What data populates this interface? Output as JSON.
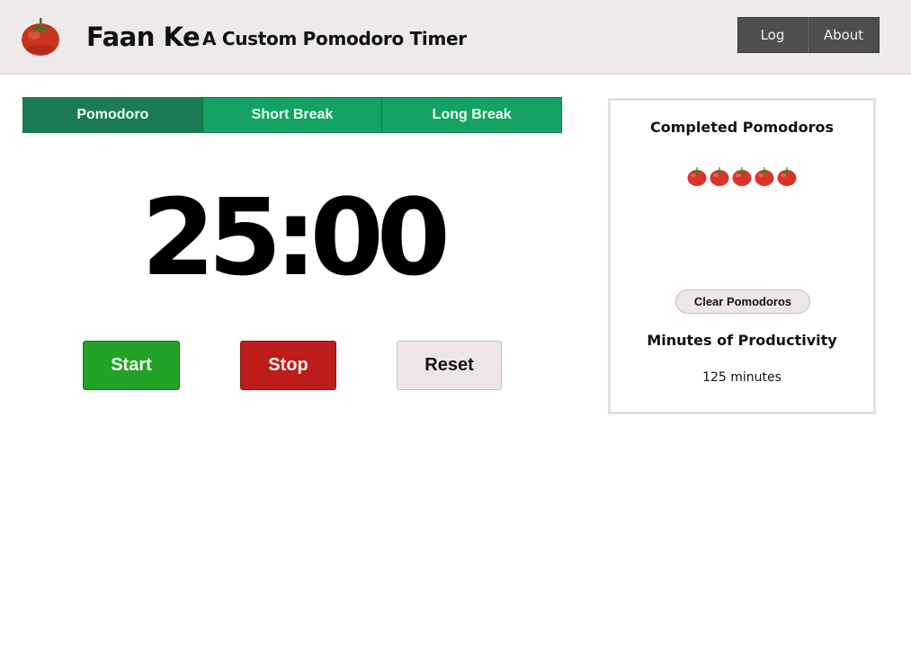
{
  "header": {
    "logo_icon": "tomato-icon",
    "app_name": "Faan Ke",
    "tagline": "A Custom Pomodoro Timer",
    "nav": [
      {
        "label": "Log"
      },
      {
        "label": "About"
      }
    ]
  },
  "tabs": [
    {
      "label": "Pomodoro",
      "active": true
    },
    {
      "label": "Short Break",
      "active": false
    },
    {
      "label": "Long Break",
      "active": false
    }
  ],
  "timer": {
    "display": "25:00"
  },
  "controls": {
    "start_label": "Start",
    "stop_label": "Stop",
    "reset_label": "Reset"
  },
  "panel": {
    "completed_title": "Completed Pomodoros",
    "completed_count": 5,
    "tomato_icon": "tomato-icon",
    "clear_label": "Clear Pomodoros",
    "productivity_title": "Minutes of Productivity",
    "productivity_value": "125 minutes"
  },
  "colors": {
    "header_bg": "#eeeae9",
    "tab_green": "#14a362",
    "tab_active": "#1b7b55",
    "start_green": "#22a227",
    "stop_red": "#bd1d1b",
    "reset_bg": "#eee6e6",
    "nav_bg": "#4e4e4e"
  }
}
